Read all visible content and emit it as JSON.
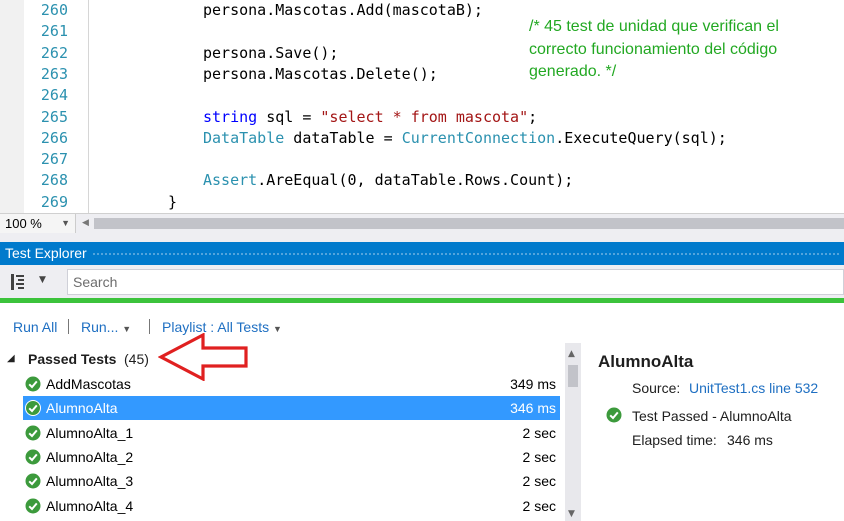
{
  "editor": {
    "lines": [
      {
        "num": "260",
        "tokens": [
          {
            "t": "persona.Mascotas.Add(mascotaB);",
            "c": ""
          }
        ],
        "indent": 1
      },
      {
        "num": "261",
        "tokens": [],
        "indent": 0
      },
      {
        "num": "262",
        "tokens": [
          {
            "t": "persona.Save();",
            "c": ""
          }
        ],
        "indent": 1
      },
      {
        "num": "263",
        "tokens": [
          {
            "t": "persona.Mascotas.Delete();",
            "c": ""
          }
        ],
        "indent": 1
      },
      {
        "num": "264",
        "tokens": [],
        "indent": 0
      },
      {
        "num": "265",
        "tokens": [
          {
            "t": "string",
            "c": "kw"
          },
          {
            "t": " sql = ",
            "c": ""
          },
          {
            "t": "\"select * from mascota\"",
            "c": "st"
          },
          {
            "t": ";",
            "c": ""
          }
        ],
        "indent": 1
      },
      {
        "num": "266",
        "tokens": [
          {
            "t": "DataTable",
            "c": "ty"
          },
          {
            "t": " dataTable = ",
            "c": ""
          },
          {
            "t": "CurrentConnection",
            "c": "ty"
          },
          {
            "t": ".ExecuteQuery(sql);",
            "c": ""
          }
        ],
        "indent": 1
      },
      {
        "num": "267",
        "tokens": [],
        "indent": 0
      },
      {
        "num": "268",
        "tokens": [
          {
            "t": "Assert",
            "c": "ty"
          },
          {
            "t": ".AreEqual(0, dataTable.Rows.Count);",
            "c": ""
          }
        ],
        "indent": 1
      },
      {
        "num": "269",
        "tokens": [
          {
            "t": "}",
            "c": ""
          }
        ],
        "indent": 2
      }
    ],
    "comment": "/* 45 test de unidad que verifican el correcto funcionamiento del código generado. */",
    "zoom": "100 %"
  },
  "test_explorer": {
    "title": "Test Explorer",
    "search_placeholder": "Search",
    "actions": {
      "run_all": "Run All",
      "run": "Run...",
      "playlist": "Playlist : All Tests"
    },
    "group": {
      "label": "Passed Tests",
      "count": "(45)"
    },
    "tests": [
      {
        "name": "AddMascotas",
        "time": "349 ms",
        "selected": false
      },
      {
        "name": "AlumnoAlta",
        "time": "346 ms",
        "selected": true
      },
      {
        "name": "AlumnoAlta_1",
        "time": "2 sec",
        "selected": false
      },
      {
        "name": "AlumnoAlta_2",
        "time": "2 sec",
        "selected": false
      },
      {
        "name": "AlumnoAlta_3",
        "time": "2 sec",
        "selected": false
      },
      {
        "name": "AlumnoAlta_4",
        "time": "2 sec",
        "selected": false
      }
    ],
    "details": {
      "title": "AlumnoAlta",
      "source_label": "Source:",
      "source_link": "UnitTest1.cs line 532",
      "status": "Test Passed - AlumnoAlta",
      "elapsed_label": "Elapsed time:",
      "elapsed": "346 ms"
    }
  },
  "colors": {
    "accent": "#007acc",
    "passed_green": "#3cc33c",
    "selection": "#3399ff",
    "link": "#1e6fc2",
    "annotation": "#e02020",
    "comment_green": "#22a822"
  },
  "icons": {
    "group_by": "group-by-icon",
    "passed": "check-circle-icon",
    "annotation": "red-arrow-icon"
  }
}
